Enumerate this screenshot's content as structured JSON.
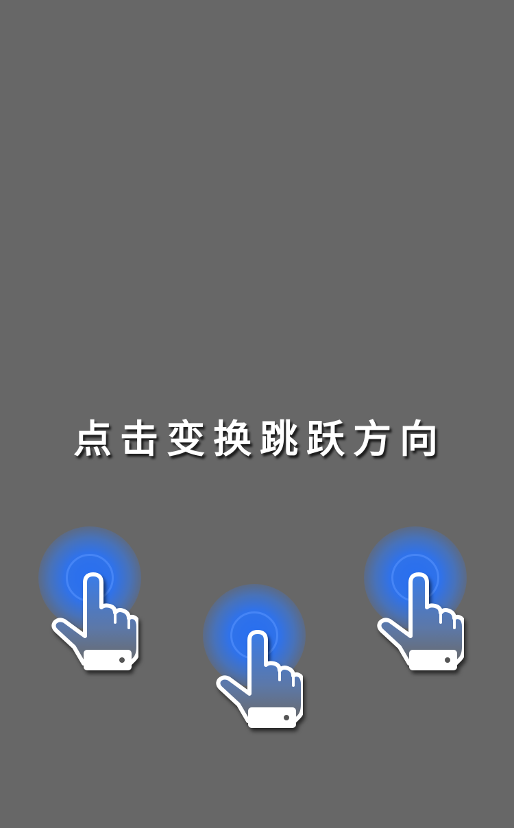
{
  "screen": {
    "background_color": "#676767"
  },
  "tutorial": {
    "hint_text": "点击变换跳跃方向",
    "tap_indicators": [
      {
        "icon": "pointing-hand-icon",
        "glow_color": "#2f6ff0"
      },
      {
        "icon": "pointing-hand-icon",
        "glow_color": "#2f6ff0"
      },
      {
        "icon": "pointing-hand-icon",
        "glow_color": "#2f6ff0"
      }
    ]
  }
}
